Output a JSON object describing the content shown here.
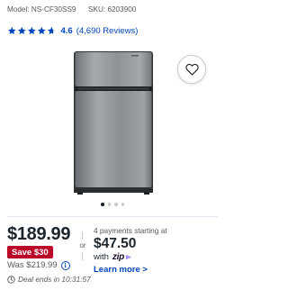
{
  "product": {
    "model_label": "Model:",
    "model_value": "NS-CF30SS9",
    "sku_label": "SKU:",
    "sku_value": "6203900"
  },
  "rating": {
    "stars": 4.6,
    "value": "4.6",
    "reviews": "(4,690 Reviews)",
    "star_color": "#0046be"
  },
  "gallery": {
    "image_count": 4,
    "active_index": 0
  },
  "pricing": {
    "price": "$189.99",
    "save_badge": "Save $30",
    "was_price": "Was $219.99",
    "info_icon": "info-icon",
    "info_icon_glyph": "i",
    "deal_timer": "Deal ends in 10:31:57",
    "save_color": "#bb0628"
  },
  "financing": {
    "or_text": "or",
    "installments": "4 payments starting at",
    "amount": "$47.50",
    "with_text": "with",
    "provider": "zip",
    "learn_more": "Learn more >"
  },
  "colors": {
    "accent": "#0046be",
    "text": "#1d252c"
  }
}
